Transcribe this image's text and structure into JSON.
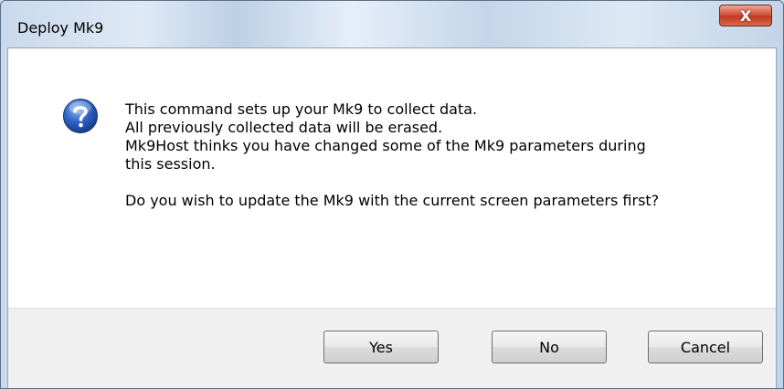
{
  "window": {
    "title": "Deploy Mk9",
    "close_glyph": "X"
  },
  "icon": "question-icon",
  "message": {
    "line1": "This command sets up your Mk9 to collect data.",
    "line2": "All previously collected data will be erased.",
    "line3": "Mk9Host thinks you have changed some of the Mk9 parameters during",
    "line4": "this session.",
    "line5": "Do you wish to update the Mk9 with the current screen parameters first?"
  },
  "buttons": {
    "yes": "Yes",
    "no": "No",
    "cancel": "Cancel"
  },
  "colors": {
    "close_button": "#c13a22",
    "icon_blue": "#1f4fa8"
  }
}
